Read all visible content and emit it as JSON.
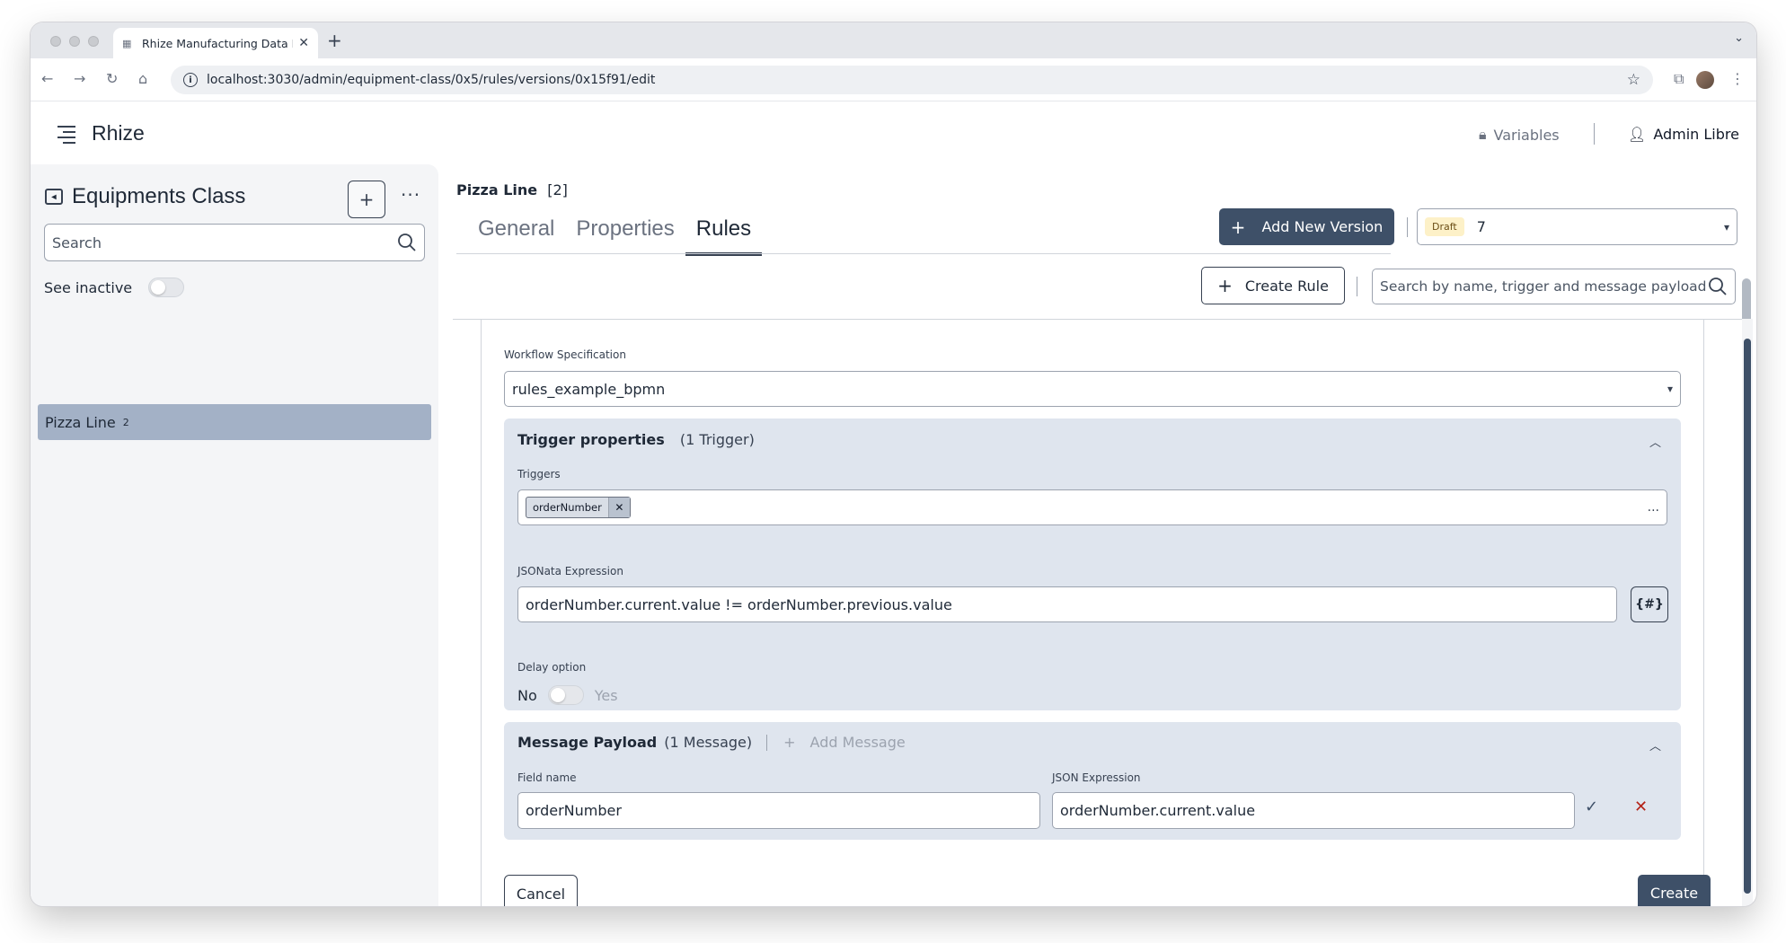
{
  "browser": {
    "tab_title": "Rhize Manufacturing Data Hu",
    "url": "localhost:3030/admin/equipment-class/0x5/rules/versions/0x15f91/edit",
    "new_tab": "+",
    "close": "✕"
  },
  "app": {
    "brand": "Rhize",
    "variables_label": "Variables",
    "user_name": "Admin Libre"
  },
  "sidebar": {
    "title": "Equipments Class",
    "search_placeholder": "Search",
    "see_inactive_label": "See inactive",
    "items": [
      {
        "label": "Pizza Line",
        "count": "2"
      }
    ]
  },
  "main": {
    "breadcrumb_name": "Pizza Line",
    "breadcrumb_count": "[2]",
    "tabs": [
      {
        "label": "General"
      },
      {
        "label": "Properties"
      },
      {
        "label": "Rules"
      }
    ],
    "add_version_label": "Add New Version",
    "version_badge": "Draft",
    "version_value": "7",
    "create_rule_label": "Create Rule",
    "rule_search_placeholder": "Search by name, trigger and message payload"
  },
  "form": {
    "workflow_label": "Workflow Specification",
    "workflow_value": "rules_example_bpmn",
    "trigger_title": "Trigger properties",
    "trigger_count": "(1 Trigger)",
    "triggers_label": "Triggers",
    "trigger_chips": [
      "orderNumber"
    ],
    "trigger_more": "...",
    "jsonata_label": "JSONata Expression",
    "jsonata_value": "orderNumber.current.value != orderNumber.previous.value",
    "expr_button": "{#}",
    "delay_label": "Delay option",
    "delay_no": "No",
    "delay_yes": "Yes",
    "message_title": "Message Payload",
    "message_count": "(1 Message)",
    "add_message_label": "Add Message",
    "field_name_label": "Field name",
    "field_name_value": "orderNumber",
    "json_expr_label": "JSON Expression",
    "json_expr_value": "orderNumber.current.value",
    "cancel_label": "Cancel",
    "create_label": "Create"
  }
}
